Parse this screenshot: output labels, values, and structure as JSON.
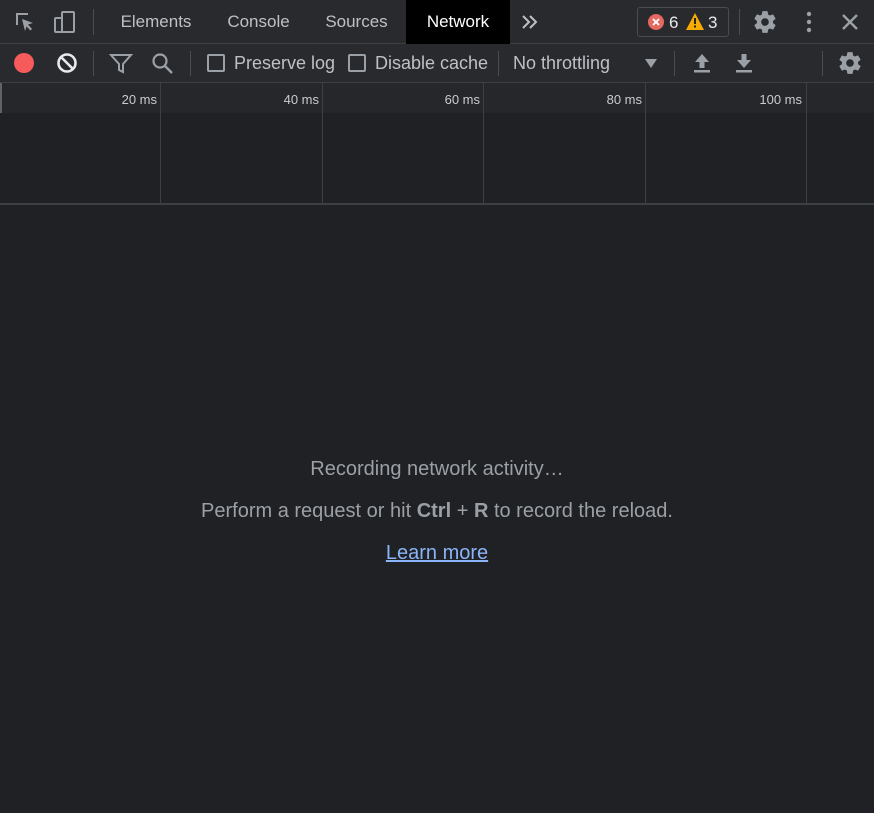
{
  "tabs": [
    {
      "label": "Elements"
    },
    {
      "label": "Console"
    },
    {
      "label": "Sources"
    },
    {
      "label": "Network",
      "active": true
    }
  ],
  "issues": {
    "errors": "6",
    "warnings": "3"
  },
  "toolbar": {
    "preserve_log_label": "Preserve log",
    "disable_cache_label": "Disable cache",
    "throttling_value": "No throttling",
    "record_color": "#f55b5b"
  },
  "timeline": {
    "ticks": [
      "20 ms",
      "40 ms",
      "60 ms",
      "80 ms",
      "100 ms"
    ]
  },
  "empty_state": {
    "line1": "Recording network activity…",
    "line2_prefix": "Perform a request or hit ",
    "line2_key1": "Ctrl",
    "line2_plus": " + ",
    "line2_key2": "R",
    "line2_suffix": " to record the reload.",
    "learn_more": "Learn more"
  },
  "icons": {
    "inspect": "inspect-element-icon",
    "device": "device-toolbar-icon",
    "more_tabs": "chevron-double-right-icon",
    "error": "error-circle-icon",
    "warning": "warning-triangle-icon",
    "settings": "gear-icon",
    "menu": "kebab-menu-icon",
    "close": "close-icon",
    "record": "record-icon",
    "clear": "clear-icon",
    "filter": "filter-icon",
    "search": "search-icon",
    "import": "upload-icon",
    "export": "download-icon"
  }
}
